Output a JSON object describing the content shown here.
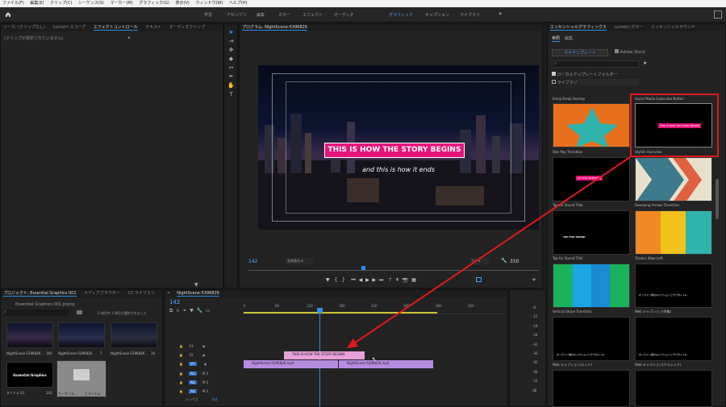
{
  "menubar": {
    "items": [
      "ファイル(F)",
      "編集(E)",
      "クリップ(C)",
      "シーケンス(S)",
      "マーカー(M)",
      "グラフィック(G)",
      "表示(V)",
      "ウィンドウ(W)",
      "ヘルプ(H)"
    ]
  },
  "workspaces": {
    "tabs": [
      "学習",
      "アセンブリ",
      "編集",
      "カラー",
      "エフェクト",
      "オーディオ",
      "グラフィック",
      "キャプション",
      "ライブラリ"
    ],
    "more": "»"
  },
  "source_panel": {
    "tabs": [
      "ソース: (クリップなし)",
      "Lumetri スコープ",
      "エフェクトコントロール",
      "テキスト",
      "オーディオクリップ"
    ],
    "empty": "(クリップが選択されていません)"
  },
  "program": {
    "title": "プログラム: NightScene-5396826",
    "title_text": "THIS IS HOW THE STORY BEGINS",
    "subtitle_text": "and this is how it ends",
    "timecode": "142",
    "fit": "全体表示",
    "full": "フル",
    "end_time": "350"
  },
  "project": {
    "tabs": [
      "プロジェクト: Essential Graphics 001",
      "メディアブラウザー",
      "CC ライブラリ"
    ],
    "file": "Essential Graphics 001.prproj",
    "selection": "1 項目中 1 項目が選択されました",
    "items": [
      {
        "name": "NightScene-5396826...",
        "dur": "160"
      },
      {
        "name": "NightScene-5396826...",
        "dur": "7"
      },
      {
        "name": "NightScene-5396826...",
        "dur": "34"
      },
      {
        "name": "タイトル 01",
        "dur": "143",
        "thumb_text": "Essential Graphics"
      },
      {
        "name": "サーケンス...",
        "dur": "1 アイテム"
      }
    ]
  },
  "timeline": {
    "tab": "NightScene-5396826",
    "timecode": "142",
    "ruler": [
      "0",
      "60",
      "120",
      "180",
      "240",
      "300",
      "360",
      "420"
    ],
    "tracks": [
      {
        "name": "V3"
      },
      {
        "name": "V2"
      },
      {
        "name": "V1"
      },
      {
        "name": "A1"
      },
      {
        "name": "A2"
      },
      {
        "name": "A3"
      }
    ],
    "mix": "ミックス",
    "mix_val": "0.0",
    "clips": {
      "title": "THIS IS HOW THE STORY BEGINS",
      "v1a": "NightScene-5396826.mp4",
      "v1b": "NightScene-5396826.mp4"
    }
  },
  "meter": {
    "scale": [
      "-6",
      "-12",
      "-18",
      "-24",
      "-30",
      "-36",
      "-42",
      "-48",
      "-54",
      "dB"
    ]
  },
  "eg": {
    "tabs": [
      "エッセンシャルグラフィックス",
      "Lumetri カラー",
      "エッセンシャルサウンド"
    ],
    "subtabs": [
      "参照",
      "編集"
    ],
    "source_tabs": [
      "マイテンプレート",
      "Adobe Stock"
    ],
    "chk_local": "ローカルテンプレートフォルダー",
    "chk_lib": "ライブラリ",
    "lib_value": "",
    "templates": [
      {
        "name": "Emoji Emoji Overlay"
      },
      {
        "name": "Social Media Subscribe Button"
      },
      {
        "name": "Star Pop Transition"
      },
      {
        "name": "Stylish Overview"
      },
      {
        "name": "Tap for Sound Title",
        "badge": "TAP FOR SOUND"
      },
      {
        "name": "Sweeping Arrows Transition"
      },
      {
        "name": "Tap for Sound Title"
      },
      {
        "name": "Tricolor Wipe Left"
      },
      {
        "name": "Vertical Stripe Transition"
      },
      {
        "name": "Web キャプション(特集)",
        "preview": "オンライン用のキャプションとサブタイトル"
      },
      {
        "name": "Web キャプション(エンド)",
        "preview": "オンライン用のキャプションとサブタイトル"
      },
      {
        "name": "Web キャプション(クラシック)",
        "preview": "オンライン用のキャプションとサブタイトル"
      }
    ],
    "overview_badge": "STYLISH OVERVIEW",
    "subscribe_text": "THIS IS HOW THE STORY BEGINS"
  },
  "colors": {
    "accent": "#2d8ceb",
    "title_bg": "#e6147a",
    "highlight": "#e0191a",
    "v1": "#b58ce0",
    "title_clip": "#e6a0d6"
  }
}
